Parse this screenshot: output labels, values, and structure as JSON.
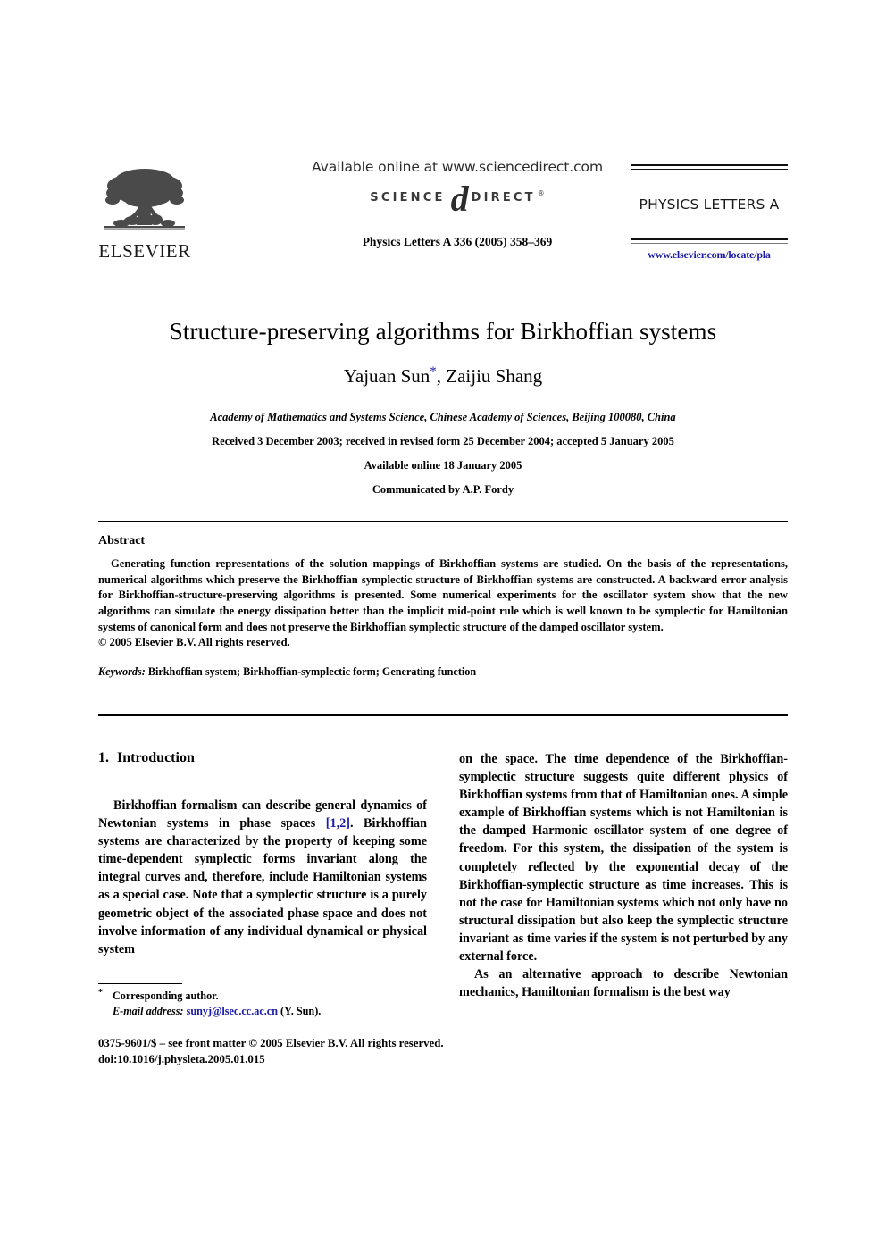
{
  "masthead": {
    "publisher_name": "ELSEVIER",
    "available_online": "Available online at www.sciencedirect.com",
    "sciencedirect": {
      "science_word": "SCIENCE",
      "direct_word": "DIRECT",
      "at_glyph": "d",
      "registered_mark": "®"
    },
    "journal_ref": "Physics Letters A 336 (2005) 358–369",
    "journal_title": "PHYSICS LETTERS A",
    "elsevier_url": "www.elsevier.com/locate/pla"
  },
  "article": {
    "title": "Structure-preserving algorithms for Birkhoffian systems",
    "authors": "Yajuan Sun",
    "author_star": "*",
    "authors_rest": ", Zaijiu Shang",
    "affiliation": "Academy of Mathematics and Systems Science, Chinese Academy of Sciences, Beijing 100080, China",
    "history": "Received 3 December 2003; received in revised form 25 December 2004; accepted 5 January 2005",
    "available_online": "Available online 18 January 2005",
    "communicated": "Communicated by A.P. Fordy"
  },
  "abstract": {
    "heading": "Abstract",
    "body": "Generating function representations of the solution mappings of Birkhoffian systems are studied. On the basis of the representations, numerical algorithms which preserve the Birkhoffian symplectic structure of Birkhoffian systems are constructed. A backward error analysis for Birkhoffian-structure-preserving algorithms is presented. Some numerical experiments for the oscillator system show that the new algorithms can simulate the energy dissipation better than the implicit mid-point rule which is well known to be symplectic for Hamiltonian systems of canonical form and does not preserve the Birkhoffian symplectic structure of the damped oscillator system.",
    "copyright": "© 2005 Elsevier B.V. All rights reserved.",
    "keywords_label": "Keywords:",
    "keywords_value": "Birkhoffian system; Birkhoffian-symplectic form; Generating function"
  },
  "body": {
    "section_number": "1.",
    "section_title": "Introduction",
    "left_para_1a": "Birkhoffian formalism can describe general dynamics of Newtonian systems in phase spaces ",
    "left_cite": "[1,2]",
    "left_para_1b": ". Birkhoffian systems are characterized by the property of keeping some time-dependent symplectic forms invariant along the integral curves and, therefore, include Hamiltonian systems as a special case. Note that a symplectic structure is a purely geometric object of the associated phase space and does not involve information of any individual dynamical or physical system",
    "right_para_1": "on the space. The time dependence of the Birkhoffian-symplectic structure suggests quite different physics of Birkhoffian systems from that of Hamiltonian ones. A simple example of Birkhoffian systems which is not Hamiltonian is the damped Harmonic oscillator system of one degree of freedom. For this system, the dissipation of the system is completely reflected by the exponential decay of the Birkhoffian-symplectic structure as time increases. This is not the case for Hamiltonian systems which not only have no structural dissipation but also keep the symplectic structure invariant as time varies if the system is not perturbed by any external force.",
    "right_para_2": "As an alternative approach to describe Newtonian mechanics, Hamiltonian formalism is the best way"
  },
  "footnote": {
    "star": "*",
    "corresponding": "Corresponding author.",
    "email_label": "E-mail address:",
    "email": "sunyj@lsec.cc.ac.cn",
    "email_suffix": "(Y. Sun)."
  },
  "page_footer": {
    "issn_line": "0375-9601/$ – see front matter  © 2005 Elsevier B.V. All rights reserved.",
    "doi_line": "doi:10.1016/j.physleta.2005.01.015"
  },
  "colors": {
    "link": "#1a1aa8",
    "text": "#000000",
    "background": "#ffffff"
  }
}
